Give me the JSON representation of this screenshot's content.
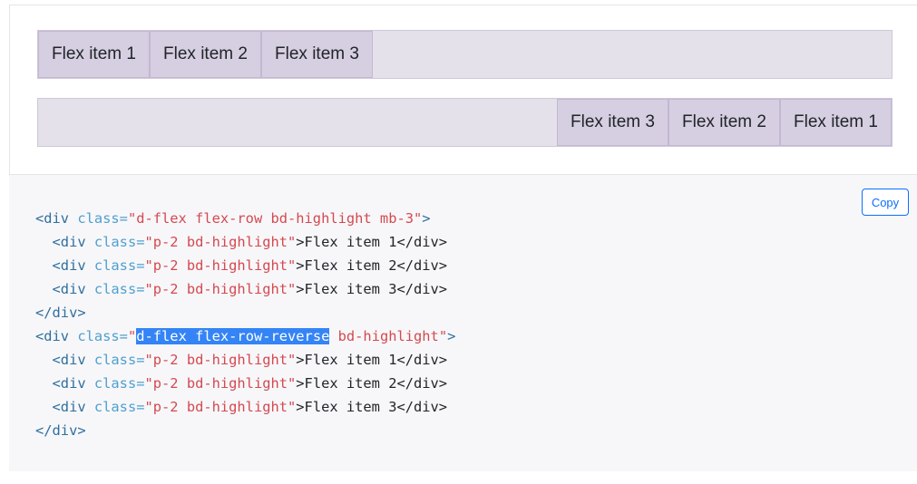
{
  "example": {
    "row1_items": [
      "Flex item 1",
      "Flex item 2",
      "Flex item 3"
    ],
    "row2_items": [
      "Flex item 1",
      "Flex item 2",
      "Flex item 3"
    ]
  },
  "code": {
    "copy_label": "Copy",
    "lines": [
      [
        "<div",
        " class=",
        "\"d-flex flex-row bd-highlight mb-3\"",
        ">"
      ],
      [
        "  <div",
        " class=",
        "\"p-2 bd-highlight\"",
        ">Flex item 1</div>"
      ],
      [
        "  <div",
        " class=",
        "\"p-2 bd-highlight\"",
        ">Flex item 2</div>"
      ],
      [
        "  <div",
        " class=",
        "\"p-2 bd-highlight\"",
        ">Flex item 3</div>"
      ],
      [
        "</div>"
      ],
      [
        "<div",
        " class=",
        "\"",
        "d-flex flex-row-reverse",
        " bd-highlight\"",
        ">"
      ],
      [
        "  <div",
        " class=",
        "\"p-2 bd-highlight\"",
        ">Flex item 1</div>"
      ],
      [
        "  <div",
        " class=",
        "\"p-2 bd-highlight\"",
        ">Flex item 2</div>"
      ],
      [
        "  <div",
        " class=",
        "\"p-2 bd-highlight\"",
        ">Flex item 3</div>"
      ],
      [
        "</div>"
      ]
    ]
  },
  "colors": {
    "tag": "#2f6f9f",
    "attr": "#4f9fcf",
    "value": "#d44950",
    "selection": "#3484f6",
    "accent": "#0d6efd"
  }
}
